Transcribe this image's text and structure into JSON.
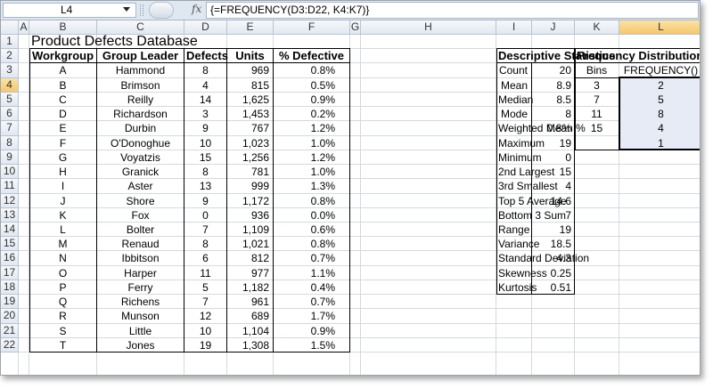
{
  "formula_bar": {
    "name_box": "L4",
    "formula": "{=FREQUENCY(D3:D22, K4:K7)}",
    "fx_label": "fx"
  },
  "columns": [
    "A",
    "B",
    "C",
    "D",
    "E",
    "F",
    "G",
    "H",
    "I",
    "J",
    "K",
    "L"
  ],
  "rows": [
    "1",
    "2",
    "3",
    "4",
    "5",
    "6",
    "7",
    "8",
    "9",
    "10",
    "11",
    "12",
    "13",
    "14",
    "15",
    "16",
    "17",
    "18",
    "19",
    "20",
    "21",
    "22"
  ],
  "active": {
    "col": "L",
    "row": "4"
  },
  "title": "Product Defects Database",
  "table": {
    "headers": [
      "Workgroup",
      "Group Leader",
      "Defects",
      "Units",
      "% Defective"
    ],
    "rows": [
      [
        "A",
        "Hammond",
        "8",
        "969",
        "0.8%"
      ],
      [
        "B",
        "Brimson",
        "4",
        "815",
        "0.5%"
      ],
      [
        "C",
        "Reilly",
        "14",
        "1,625",
        "0.9%"
      ],
      [
        "D",
        "Richardson",
        "3",
        "1,453",
        "0.2%"
      ],
      [
        "E",
        "Durbin",
        "9",
        "767",
        "1.2%"
      ],
      [
        "F",
        "O'Donoghue",
        "10",
        "1,023",
        "1.0%"
      ],
      [
        "G",
        "Voyatzis",
        "15",
        "1,256",
        "1.2%"
      ],
      [
        "H",
        "Granick",
        "8",
        "781",
        "1.0%"
      ],
      [
        "I",
        "Aster",
        "13",
        "999",
        "1.3%"
      ],
      [
        "J",
        "Shore",
        "9",
        "1,172",
        "0.8%"
      ],
      [
        "K",
        "Fox",
        "0",
        "936",
        "0.0%"
      ],
      [
        "L",
        "Bolter",
        "7",
        "1,109",
        "0.6%"
      ],
      [
        "M",
        "Renaud",
        "8",
        "1,021",
        "0.8%"
      ],
      [
        "N",
        "Ibbitson",
        "6",
        "812",
        "0.7%"
      ],
      [
        "O",
        "Harper",
        "11",
        "977",
        "1.1%"
      ],
      [
        "P",
        "Ferry",
        "5",
        "1,182",
        "0.4%"
      ],
      [
        "Q",
        "Richens",
        "7",
        "961",
        "0.7%"
      ],
      [
        "R",
        "Munson",
        "12",
        "689",
        "1.7%"
      ],
      [
        "S",
        "Little",
        "10",
        "1,104",
        "0.9%"
      ],
      [
        "T",
        "Jones",
        "19",
        "1,308",
        "1.5%"
      ]
    ]
  },
  "stats": {
    "header": "Descriptive Statistics",
    "rows": [
      [
        "Count",
        "20"
      ],
      [
        "Mean",
        "8.9"
      ],
      [
        "Median",
        "8.5"
      ],
      [
        "Mode",
        "8"
      ],
      [
        "Weighted Mean %",
        "0.8%"
      ],
      [
        "Maximum",
        "19"
      ],
      [
        "Minimum",
        "0"
      ],
      [
        "2nd Largest",
        "15"
      ],
      [
        "3rd Smallest",
        "4"
      ],
      [
        "Top 5 Average",
        "14.6"
      ],
      [
        "Bottom 3 Sum",
        "7"
      ],
      [
        "Range",
        "19"
      ],
      [
        "Variance",
        "18.5"
      ],
      [
        "Standard Deviation",
        "4.3"
      ],
      [
        "Skewness",
        "0.25"
      ],
      [
        "Kurtosis",
        "0.51"
      ]
    ]
  },
  "frequency": {
    "header": "Frequency Distribution",
    "col_headers": [
      "Bins",
      "FREQUENCY()"
    ],
    "bins": [
      "3",
      "7",
      "11",
      "15",
      ""
    ],
    "counts": [
      "2",
      "5",
      "8",
      "4",
      "1"
    ]
  }
}
